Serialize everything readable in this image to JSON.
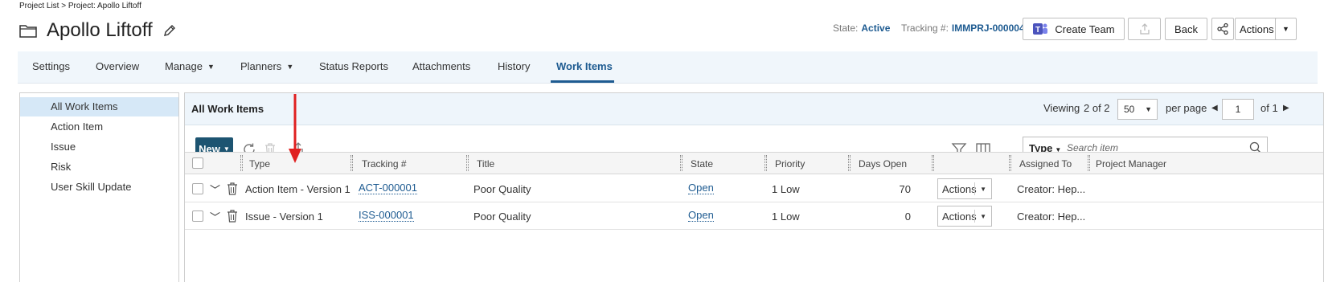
{
  "breadcrumb": {
    "text": "Project List > Project: Apollo Liftoff"
  },
  "header": {
    "title": "Apollo Liftoff",
    "state_label": "State:",
    "state_value": "Active",
    "tracking_label": "Tracking #:",
    "tracking_value": "IMMPRJ-000004",
    "create_team_label": "Create Team",
    "back_label": "Back",
    "actions_label": "Actions"
  },
  "tabs": [
    {
      "label": "Settings"
    },
    {
      "label": "Overview"
    },
    {
      "label": "Manage"
    },
    {
      "label": "Planners"
    },
    {
      "label": "Status Reports"
    },
    {
      "label": "Attachments"
    },
    {
      "label": "History"
    },
    {
      "label": "Work Items"
    }
  ],
  "sidebar": {
    "items": [
      {
        "label": "All Work Items"
      },
      {
        "label": "Action Item"
      },
      {
        "label": "Issue"
      },
      {
        "label": "Risk"
      },
      {
        "label": "User Skill Update"
      }
    ]
  },
  "panel": {
    "title": "All Work Items",
    "viewing": "Viewing",
    "viewing_count": "2 of 2",
    "per_page_value": "50",
    "per_page_label": "per page",
    "page_value": "1",
    "of_pages": "of 1"
  },
  "toolbar": {
    "new_label": "New",
    "search_type": "Type",
    "search_placeholder": "Search item"
  },
  "grid": {
    "columns": [
      "Type",
      "Tracking #",
      "Title",
      "State",
      "Priority",
      "Days Open",
      "",
      "Assigned To",
      "Project Manager"
    ],
    "rows": [
      {
        "type": "Action Item - Version 1",
        "tracking": "ACT-000001",
        "title": "Poor Quality",
        "state": "Open",
        "priority": "1 Low",
        "days_open": "70",
        "actions": "Actions",
        "assigned_to": "Creator: Hep..."
      },
      {
        "type": "Issue - Version 1",
        "tracking": "ISS-000001",
        "title": "Poor Quality",
        "state": "Open",
        "priority": "1 Low",
        "days_open": "0",
        "actions": "Actions",
        "assigned_to": "Creator: Hep..."
      }
    ]
  },
  "colors": {
    "accent": "#1e5b91",
    "new_button": "#1d5471",
    "tab_bar": "#f0f6fb",
    "annotation": "#e02020"
  }
}
